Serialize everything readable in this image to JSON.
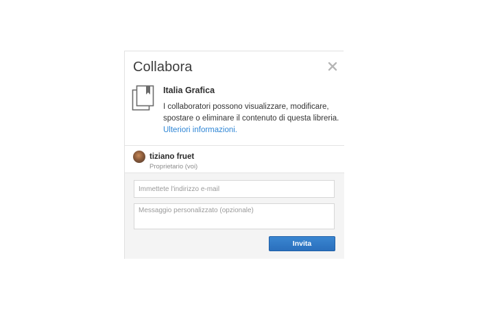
{
  "dialog": {
    "title": "Collabora",
    "close_icon": "close-icon"
  },
  "library": {
    "icon": "library-icon",
    "name": "Italia Grafica",
    "description": "I collaboratori possono visualizzare, modificare, spostare o eliminare il contenuto di questa libreria.",
    "learn_more_label": "Ulteriori informazioni."
  },
  "owner": {
    "name": "tiziano fruet",
    "role": "Proprietario (voi)"
  },
  "invite": {
    "email_placeholder": "Immettete l'indirizzo e-mail",
    "email_value": "",
    "message_placeholder": "Messaggio personalizzato (opzionale)",
    "message_value": "",
    "button_label": "Invita"
  },
  "colors": {
    "accent": "#2d85d5",
    "button": "#2a6fbd"
  }
}
